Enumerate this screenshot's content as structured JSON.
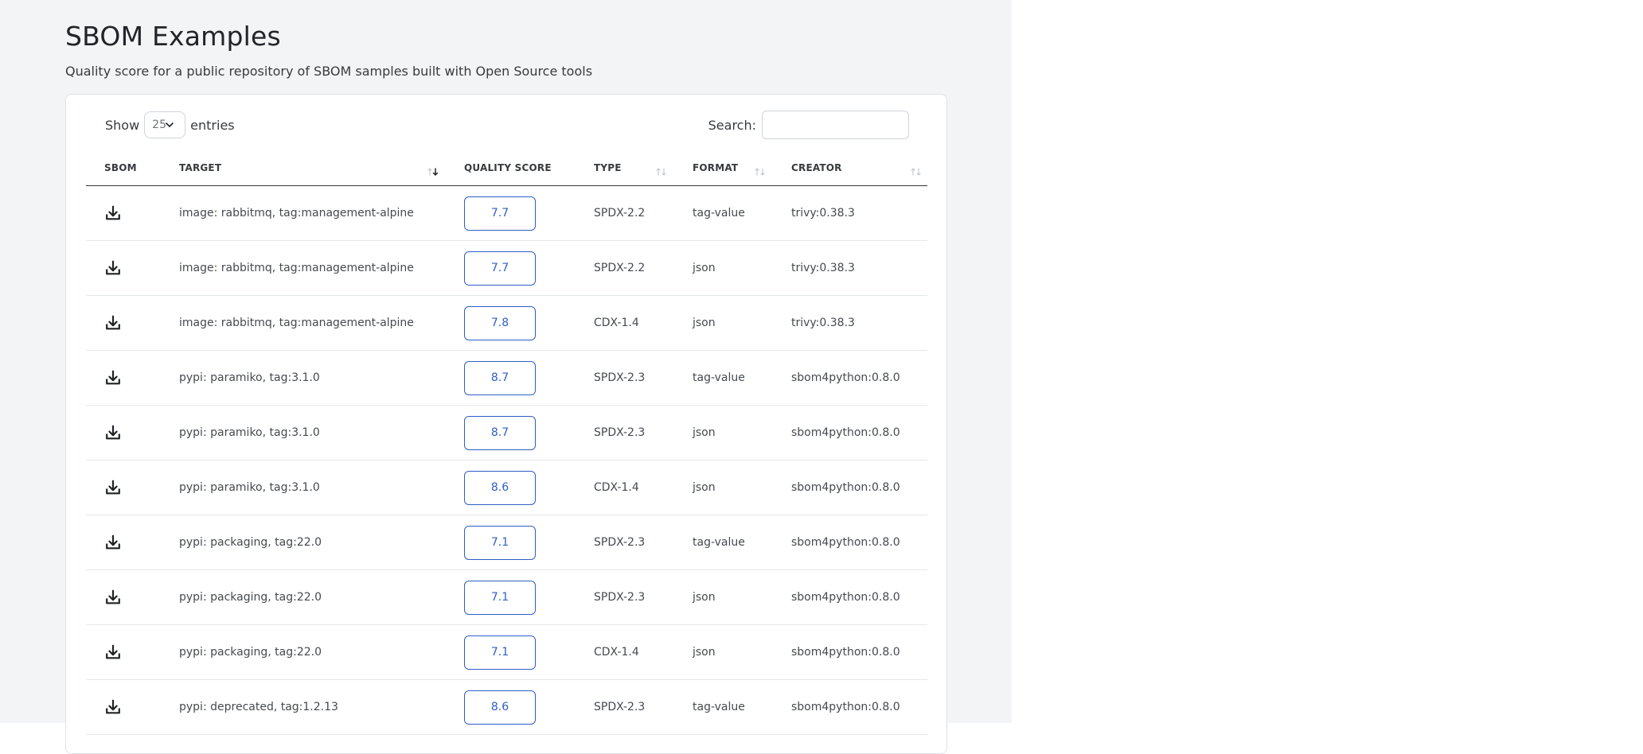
{
  "page": {
    "title": "SBOM Examples",
    "subtitle": "Quality score for a public repository of SBOM samples built with Open Source tools"
  },
  "controls": {
    "show_label": "Show",
    "entries_label": "entries",
    "length_value": "25",
    "search_label": "Search:",
    "search_value": ""
  },
  "columns": [
    {
      "label": "SBOM",
      "sortable": false
    },
    {
      "label": "TARGET",
      "sortable": true,
      "sort": "desc"
    },
    {
      "label": "QUALITY SCORE",
      "sortable": false
    },
    {
      "label": "TYPE",
      "sortable": true
    },
    {
      "label": "FORMAT",
      "sortable": true
    },
    {
      "label": "CREATOR",
      "sortable": true
    }
  ],
  "rows": [
    {
      "target": "image: rabbitmq, tag:management-alpine",
      "score": "7.7",
      "type": "SPDX-2.2",
      "format": "tag-value",
      "creator": "trivy:0.38.3"
    },
    {
      "target": "image: rabbitmq, tag:management-alpine",
      "score": "7.7",
      "type": "SPDX-2.2",
      "format": "json",
      "creator": "trivy:0.38.3"
    },
    {
      "target": "image: rabbitmq, tag:management-alpine",
      "score": "7.8",
      "type": "CDX-1.4",
      "format": "json",
      "creator": "trivy:0.38.3"
    },
    {
      "target": "pypi: paramiko, tag:3.1.0",
      "score": "8.7",
      "type": "SPDX-2.3",
      "format": "tag-value",
      "creator": "sbom4python:0.8.0"
    },
    {
      "target": "pypi: paramiko, tag:3.1.0",
      "score": "8.7",
      "type": "SPDX-2.3",
      "format": "json",
      "creator": "sbom4python:0.8.0"
    },
    {
      "target": "pypi: paramiko, tag:3.1.0",
      "score": "8.6",
      "type": "CDX-1.4",
      "format": "json",
      "creator": "sbom4python:0.8.0"
    },
    {
      "target": "pypi: packaging, tag:22.0",
      "score": "7.1",
      "type": "SPDX-2.3",
      "format": "tag-value",
      "creator": "sbom4python:0.8.0"
    },
    {
      "target": "pypi: packaging, tag:22.0",
      "score": "7.1",
      "type": "SPDX-2.3",
      "format": "json",
      "creator": "sbom4python:0.8.0"
    },
    {
      "target": "pypi: packaging, tag:22.0",
      "score": "7.1",
      "type": "CDX-1.4",
      "format": "json",
      "creator": "sbom4python:0.8.0"
    },
    {
      "target": "pypi: deprecated, tag:1.2.13",
      "score": "8.6",
      "type": "SPDX-2.3",
      "format": "tag-value",
      "creator": "sbom4python:0.8.0"
    }
  ],
  "icons": {
    "download": "download-icon",
    "sort_desc": "sort-desc-icon",
    "sort_both": "sort-both-icon",
    "chevron": "chevron-down-icon"
  },
  "colors": {
    "left_panel_bg": "#f3f4f6",
    "accent": "#2f5ec4"
  }
}
